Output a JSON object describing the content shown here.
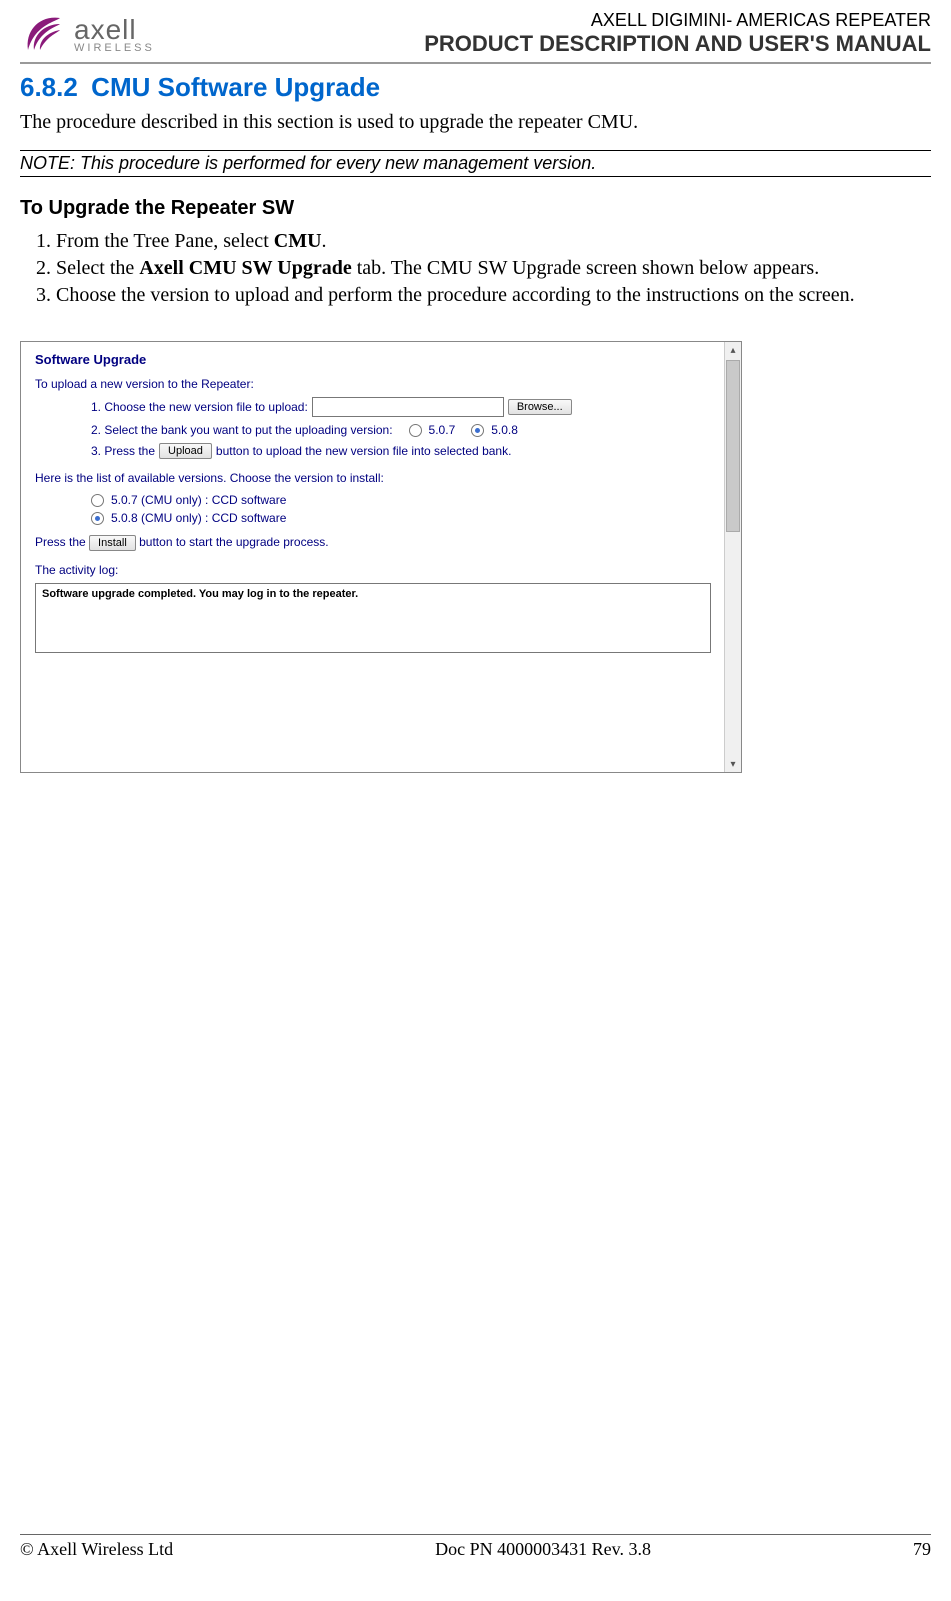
{
  "header": {
    "logo_word": "axell",
    "logo_sub": "WIRELESS",
    "top_small": "AXELL DIGIMINI- AMERICAS REPEATER",
    "top_large": "PRODUCT DESCRIPTION AND USER'S MANUAL"
  },
  "section": {
    "number": "6.8.2",
    "title": "CMU Software Upgrade",
    "intro": "The procedure described in this section is used to upgrade the repeater CMU.",
    "note": "NOTE: This procedure is performed for every new management version.",
    "sub": "To Upgrade the Repeater SW",
    "step1_pre": "From the Tree Pane, select ",
    "step1_bold": "CMU",
    "step1_post": ".",
    "step2_pre": "Select the ",
    "step2_bold": "Axell CMU SW Upgrade",
    "step2_post": " tab. The CMU SW Upgrade screen shown below appears.",
    "step3": "Choose the version to upload and perform the procedure according to the instructions on the screen."
  },
  "screenshot": {
    "heading": "Software Upgrade",
    "intro": "To upload a new version to the Repeater:",
    "step1": "1. Choose the new version file to upload:",
    "browse_btn": "Browse...",
    "step2": "2. Select the bank you want to put the uploading version:",
    "bank1": "5.0.7",
    "bank2": "5.0.8",
    "step3_pre": "3. Press the ",
    "upload_btn": "Upload",
    "step3_post": " button to upload the new version file into selected bank.",
    "list_intro": "Here is the list of available versions. Choose the version to install:",
    "version1": "5.0.7 (CMU only) : CCD software",
    "version2": "5.0.8 (CMU only) : CCD software",
    "press_pre": "Press the ",
    "install_btn": "Install",
    "press_post": " button to start the upgrade process.",
    "activity_label": "The activity log:",
    "activity_msg": "Software upgrade completed. You may log in to the repeater."
  },
  "footer": {
    "left": "© Axell Wireless Ltd",
    "center": "Doc PN 4000003431 Rev. 3.8",
    "right": "79"
  }
}
